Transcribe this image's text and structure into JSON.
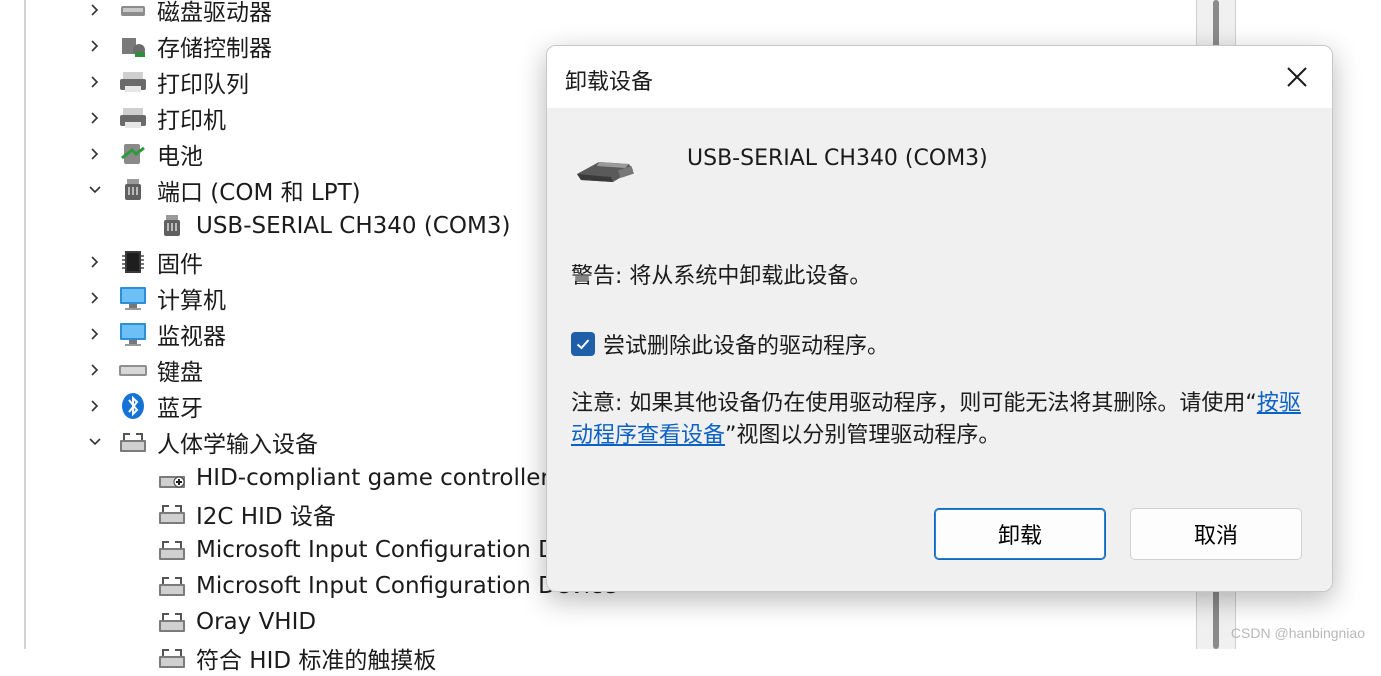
{
  "device_manager": {
    "tree_items": [
      {
        "label": "磁盘驱动器",
        "level": 0,
        "expander": "collapsed",
        "icon": "disk-drive-icon"
      },
      {
        "label": "存储控制器",
        "level": 0,
        "expander": "collapsed",
        "icon": "storage-controller-icon"
      },
      {
        "label": "打印队列",
        "level": 0,
        "expander": "collapsed",
        "icon": "print-queue-icon"
      },
      {
        "label": "打印机",
        "level": 0,
        "expander": "collapsed",
        "icon": "printer-icon"
      },
      {
        "label": "电池",
        "level": 0,
        "expander": "collapsed",
        "icon": "battery-icon"
      },
      {
        "label": "端口 (COM 和 LPT)",
        "level": 0,
        "expander": "expanded",
        "icon": "port-icon"
      },
      {
        "label": "USB-SERIAL CH340 (COM3)",
        "level": 1,
        "expander": "none",
        "icon": "port-icon"
      },
      {
        "label": "固件",
        "level": 0,
        "expander": "collapsed",
        "icon": "firmware-icon"
      },
      {
        "label": "计算机",
        "level": 0,
        "expander": "collapsed",
        "icon": "computer-icon"
      },
      {
        "label": "监视器",
        "level": 0,
        "expander": "collapsed",
        "icon": "monitor-icon"
      },
      {
        "label": "键盘",
        "level": 0,
        "expander": "collapsed",
        "icon": "keyboard-icon"
      },
      {
        "label": "蓝牙",
        "level": 0,
        "expander": "collapsed",
        "icon": "bluetooth-icon"
      },
      {
        "label": "人体学输入设备",
        "level": 0,
        "expander": "expanded",
        "icon": "hid-icon"
      },
      {
        "label": "HID-compliant game controller",
        "level": 1,
        "expander": "none",
        "icon": "game-controller-icon"
      },
      {
        "label": "I2C HID 设备",
        "level": 1,
        "expander": "none",
        "icon": "hid-icon"
      },
      {
        "label": "Microsoft Input Configuration Device",
        "level": 1,
        "expander": "none",
        "icon": "hid-icon"
      },
      {
        "label": "Microsoft Input Configuration Device",
        "level": 1,
        "expander": "none",
        "icon": "hid-icon"
      },
      {
        "label": "Oray VHID",
        "level": 1,
        "expander": "none",
        "icon": "hid-icon"
      },
      {
        "label": "符合 HID 标准的触摸板",
        "level": 1,
        "expander": "none",
        "icon": "hid-icon"
      }
    ]
  },
  "dialog": {
    "title": "卸载设备",
    "close_icon": "close-icon",
    "device_icon": "usb-serial-icon",
    "device_name": "USB-SERIAL CH340 (COM3)",
    "warning": "警告: 将从系统中卸载此设备。",
    "checkbox_label": "尝试删除此设备的驱动程序。",
    "checkbox_checked": true,
    "note_prefix": "注意: 如果其他设备仍在使用驱动程序，则可能无法将其删除。请使用“",
    "note_link": "按驱动程序查看设备",
    "note_suffix": "”视图以分别管理驱动程序。",
    "uninstall_label": "卸载",
    "cancel_label": "取消"
  },
  "watermark": "CSDN @hanbingniao",
  "colors": {
    "accent": "#0f6cbd",
    "checkbox": "#1f5fa9",
    "link": "#0b62c4"
  }
}
